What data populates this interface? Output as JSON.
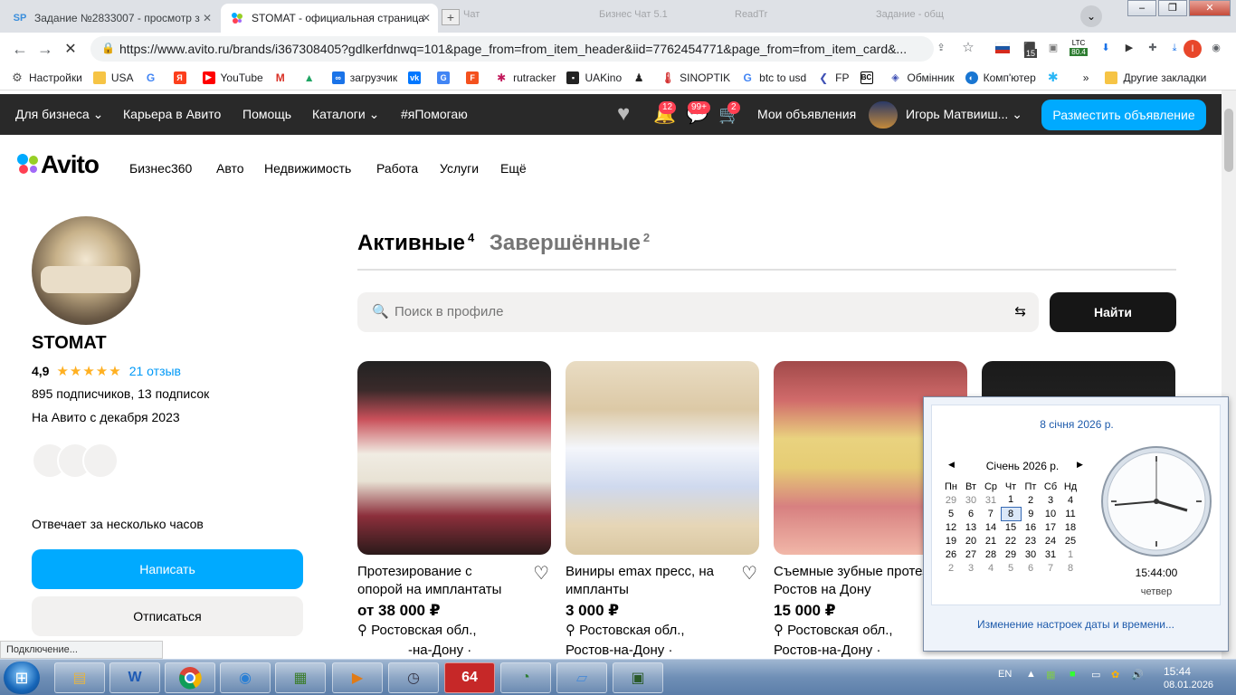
{
  "browser": {
    "tabs": [
      {
        "title": "Задание №2833007 - просмотр з",
        "icon": "SP"
      },
      {
        "title": "STOMAT - официальная страница",
        "icon": "avito"
      }
    ],
    "ghost_tabs": [
      "Чат",
      "Бизнес Чат 5.1",
      "ReadTr",
      "Задание - общ"
    ],
    "url": "https://www.avito.ru/brands/i367308405?gdlkerfdnwq=101&page_from=from_item_header&iid=7762454771&page_from=from_item_card&...",
    "ext_badges": {
      "badge1": "15",
      "ltc_label": "LTC",
      "ltc_value": "80.4",
      "profile": "I"
    },
    "bookmarks": [
      "Настройки",
      "USA",
      "YouTube",
      "загрузчик",
      "rutracker",
      "UAKino",
      "SINOPTIK",
      "btc to usd",
      "FP",
      "Обмінник",
      "Комп'ютер",
      "»",
      "Другие закладки"
    ],
    "status": "Подключение..."
  },
  "avito": {
    "topnav": {
      "business": "Для бизнеса",
      "career": "Карьера в Авито",
      "help": "Помощь",
      "catalogs": "Каталоги",
      "help_tag": "#яПомогаю",
      "notif_badge": "12",
      "msg_badge": "99+",
      "cart_badge": "2",
      "my_ads": "Мои объявления",
      "user": "Игорь Матвииш...",
      "post_button": "Разместить объявление"
    },
    "logo": "Avito",
    "catnav": [
      "Бизнес360",
      "Авто",
      "Недвижимость",
      "Работа",
      "Услуги",
      "Ещё"
    ],
    "seller": {
      "name": "STOMAT",
      "rating": "4,9",
      "stars": "★★★★★",
      "reviews": "21 отзыв",
      "subscribers": "895 подписчиков, 13 подписок",
      "since": "На Авито с декабря 2023",
      "response": "Отвечает за несколько часов",
      "write_button": "Написать",
      "unsubscribe_button": "Отписаться"
    },
    "tabs": {
      "active": "Активные",
      "active_count": "4",
      "done": "Завершённые",
      "done_count": "2"
    },
    "search": {
      "placeholder": "Поиск в профиле",
      "button": "Найти"
    },
    "cards": [
      {
        "title": "Протезирование с опорой на имплантаты",
        "price": "от 38 000 ₽",
        "loc1": "Ростовская обл.,",
        "loc2": "-на-Дону ·"
      },
      {
        "title": "Виниры emax пресс, на импланты",
        "price": "3 000 ₽",
        "loc1": "Ростовская обл.,",
        "loc2": "Ростов-на-Дону ·"
      },
      {
        "title": "Съемные зубные протез Ростов на Дону",
        "price": "15 000 ₽",
        "loc1": "Ростовская обл.,",
        "loc2": "Ростов-на-Дону ·"
      }
    ]
  },
  "calendar": {
    "date_link": "8 січня 2026 р.",
    "month": "Січень 2026 р.",
    "weekdays": [
      "Пн",
      "Вт",
      "Ср",
      "Чт",
      "Пт",
      "Сб",
      "Нд"
    ],
    "weeks": [
      [
        "29",
        "30",
        "31",
        "1",
        "2",
        "3",
        "4"
      ],
      [
        "5",
        "6",
        "7",
        "8",
        "9",
        "10",
        "11"
      ],
      [
        "12",
        "13",
        "14",
        "15",
        "16",
        "17",
        "18"
      ],
      [
        "19",
        "20",
        "21",
        "22",
        "23",
        "24",
        "25"
      ],
      [
        "26",
        "27",
        "28",
        "29",
        "30",
        "31",
        "1"
      ],
      [
        "2",
        "3",
        "4",
        "5",
        "6",
        "7",
        "8"
      ]
    ],
    "today": "8",
    "time": "15:44:00",
    "weekday": "четвер",
    "settings_link": "Изменение настроек даты и времени..."
  },
  "taskbar": {
    "lang": "EN",
    "time": "15:44",
    "date": "08.01.2026",
    "app64": "64"
  },
  "colors": {
    "avito_blue": "#00aaff",
    "badge_red": "#ff4053",
    "star": "#ffb021",
    "link": "#0099f7"
  }
}
